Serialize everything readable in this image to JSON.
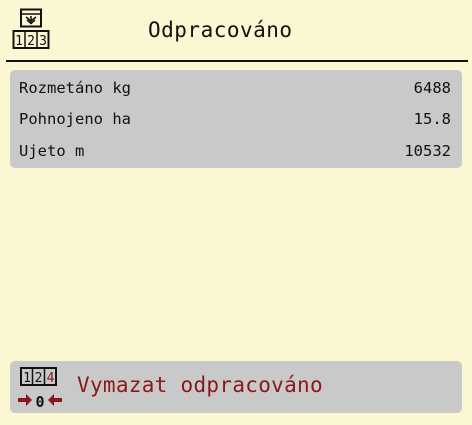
{
  "header": {
    "title": "Odpracováno",
    "icon": "work-counter-icon"
  },
  "stats": [
    {
      "label": "Rozmetáno kg",
      "value": "6488"
    },
    {
      "label": "Pohnojeno ha",
      "value": "15.8"
    },
    {
      "label": "Ujeto m",
      "value": "10532"
    }
  ],
  "reset": {
    "label": "Vymazat odpracováno",
    "icon": "reset-counter-icon",
    "counter_glyph": "0",
    "accent_color": "#8b1818"
  },
  "colors": {
    "background": "#fbf7d2",
    "panel": "#c9c9c9"
  }
}
